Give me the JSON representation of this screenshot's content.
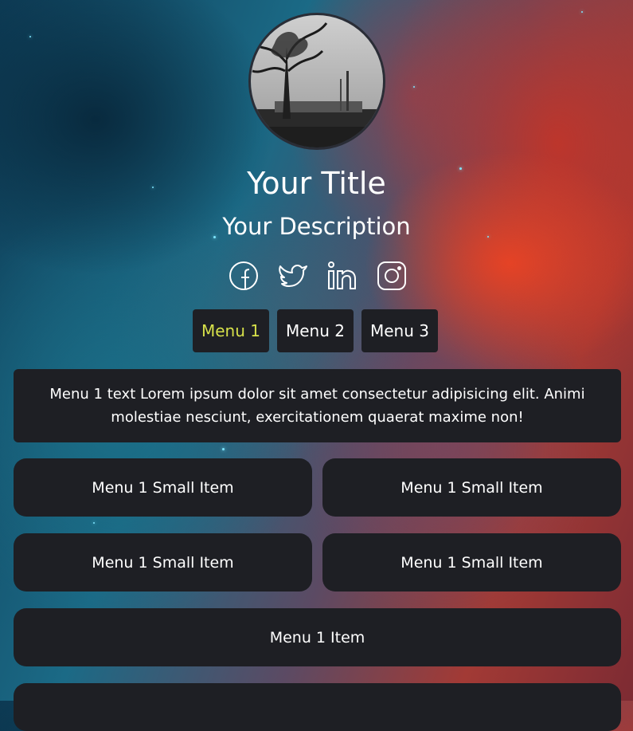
{
  "profile": {
    "title": "Your Title",
    "description": "Your Description"
  },
  "socials": [
    {
      "icon": "facebook-icon"
    },
    {
      "icon": "twitter-icon"
    },
    {
      "icon": "linkedin-icon"
    },
    {
      "icon": "instagram-icon"
    }
  ],
  "tabs": [
    {
      "label": "Menu 1",
      "active": true
    },
    {
      "label": "Menu 2",
      "active": false
    },
    {
      "label": "Menu 3",
      "active": false
    }
  ],
  "colors": {
    "card_bg": "#1e1f24",
    "active_tab": "#d6e04a",
    "text": "#ffffff"
  },
  "content": {
    "intro": "Menu 1 text Lorem ipsum dolor sit amet consectetur adipisicing elit. Animi molestiae nesciunt, exercitationem quaerat maxime non!",
    "small_items": [
      "Menu 1 Small Item",
      "Menu 1 Small Item",
      "Menu 1 Small Item",
      "Menu 1 Small Item"
    ],
    "items": [
      "Menu 1 Item"
    ]
  }
}
